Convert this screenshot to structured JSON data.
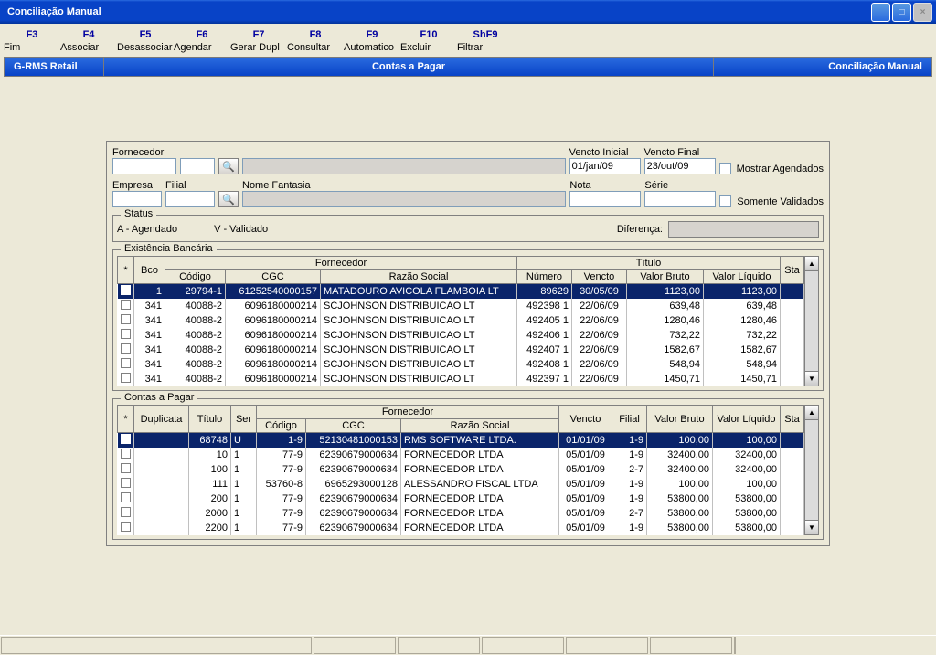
{
  "window": {
    "title": "Conciliação Manual"
  },
  "toolbar": [
    {
      "key": "F3",
      "label": "Fim"
    },
    {
      "key": "F4",
      "label": "Associar"
    },
    {
      "key": "F5",
      "label": "Desassociar"
    },
    {
      "key": "F6",
      "label": "Agendar"
    },
    {
      "key": "F7",
      "label": "Gerar Dupl"
    },
    {
      "key": "F8",
      "label": "Consultar"
    },
    {
      "key": "F9",
      "label": "Automatico"
    },
    {
      "key": "F10",
      "label": "Excluir"
    },
    {
      "key": "ShF9",
      "label": "Filtrar"
    }
  ],
  "headerbar": {
    "left": "G-RMS Retail",
    "mid": "Contas a Pagar",
    "right": "Conciliação Manual"
  },
  "filters": {
    "fornecedor_label": "Fornecedor",
    "empresa_label": "Empresa",
    "filial_label": "Filial",
    "nome_fantasia_label": "Nome Fantasia",
    "vencto_inicial_label": "Vencto Inicial",
    "vencto_final_label": "Vencto Final",
    "nota_label": "Nota",
    "serie_label": "Série",
    "vencto_inicial": "01/jan/09",
    "vencto_final": "23/out/09",
    "mostrar_agendados": "Mostrar Agendados",
    "somente_validados": "Somente Validados"
  },
  "status": {
    "group": "Status",
    "a": "A - Agendado",
    "v": "V - Validado",
    "diferenca_label": "Diferença:"
  },
  "existencia": {
    "group": "Existência Bancária",
    "header_fornecedor": "Fornecedor",
    "header_titulo": "Título",
    "cols": {
      "star": "*",
      "bco": "Bco",
      "codigo": "Código",
      "cgc": "CGC",
      "razao": "Razão Social",
      "numero": "Número",
      "vencto": "Vencto",
      "bruto": "Valor Bruto",
      "liquido": "Valor Líquido",
      "sta": "Sta"
    },
    "rows": [
      {
        "sel": true,
        "bco": "1",
        "codigo": "29794-1",
        "cgc": "61252540000157",
        "razao": "MATADOURO AVICOLA FLAMBOIA LT",
        "numero": "89629",
        "vencto": "30/05/09",
        "bruto": "1123,00",
        "liquido": "1123,00"
      },
      {
        "sel": false,
        "bco": "341",
        "codigo": "40088-2",
        "cgc": "6096180000214",
        "razao": "SCJOHNSON DISTRIBUICAO LT",
        "numero": "492398 1",
        "vencto": "22/06/09",
        "bruto": "639,48",
        "liquido": "639,48"
      },
      {
        "sel": false,
        "bco": "341",
        "codigo": "40088-2",
        "cgc": "6096180000214",
        "razao": "SCJOHNSON DISTRIBUICAO LT",
        "numero": "492405 1",
        "vencto": "22/06/09",
        "bruto": "1280,46",
        "liquido": "1280,46"
      },
      {
        "sel": false,
        "bco": "341",
        "codigo": "40088-2",
        "cgc": "6096180000214",
        "razao": "SCJOHNSON DISTRIBUICAO LT",
        "numero": "492406 1",
        "vencto": "22/06/09",
        "bruto": "732,22",
        "liquido": "732,22"
      },
      {
        "sel": false,
        "bco": "341",
        "codigo": "40088-2",
        "cgc": "6096180000214",
        "razao": "SCJOHNSON DISTRIBUICAO LT",
        "numero": "492407 1",
        "vencto": "22/06/09",
        "bruto": "1582,67",
        "liquido": "1582,67"
      },
      {
        "sel": false,
        "bco": "341",
        "codigo": "40088-2",
        "cgc": "6096180000214",
        "razao": "SCJOHNSON DISTRIBUICAO LT",
        "numero": "492408 1",
        "vencto": "22/06/09",
        "bruto": "548,94",
        "liquido": "548,94"
      },
      {
        "sel": false,
        "bco": "341",
        "codigo": "40088-2",
        "cgc": "6096180000214",
        "razao": "SCJOHNSON DISTRIBUICAO LT",
        "numero": "492397 1",
        "vencto": "22/06/09",
        "bruto": "1450,71",
        "liquido": "1450,71"
      }
    ]
  },
  "contas": {
    "group": "Contas a Pagar",
    "header_fornecedor": "Fornecedor",
    "cols": {
      "star": "*",
      "duplicata": "Duplicata",
      "titulo": "Título",
      "ser": "Ser",
      "codigo": "Código",
      "cgc": "CGC",
      "razao": "Razão Social",
      "vencto": "Vencto",
      "filial": "Filial",
      "bruto": "Valor Bruto",
      "liquido": "Valor Líquido",
      "sta": "Sta"
    },
    "rows": [
      {
        "sel": true,
        "duplicata": "",
        "titulo": "68748",
        "ser": "U",
        "codigo": "1-9",
        "cgc": "52130481000153",
        "razao": "RMS SOFTWARE LTDA.",
        "vencto": "01/01/09",
        "filial": "1-9",
        "bruto": "100,00",
        "liquido": "100,00"
      },
      {
        "sel": false,
        "duplicata": "",
        "titulo": "10",
        "ser": "1",
        "codigo": "77-9",
        "cgc": "62390679000634",
        "razao": "FORNECEDOR LTDA",
        "vencto": "05/01/09",
        "filial": "1-9",
        "bruto": "32400,00",
        "liquido": "32400,00"
      },
      {
        "sel": false,
        "duplicata": "",
        "titulo": "100",
        "ser": "1",
        "codigo": "77-9",
        "cgc": "62390679000634",
        "razao": "FORNECEDOR LTDA",
        "vencto": "05/01/09",
        "filial": "2-7",
        "bruto": "32400,00",
        "liquido": "32400,00"
      },
      {
        "sel": false,
        "duplicata": "",
        "titulo": "111",
        "ser": "1",
        "codigo": "53760-8",
        "cgc": "6965293000128",
        "razao": "ALESSANDRO FISCAL LTDA",
        "vencto": "05/01/09",
        "filial": "1-9",
        "bruto": "100,00",
        "liquido": "100,00"
      },
      {
        "sel": false,
        "duplicata": "",
        "titulo": "200",
        "ser": "1",
        "codigo": "77-9",
        "cgc": "62390679000634",
        "razao": "FORNECEDOR LTDA",
        "vencto": "05/01/09",
        "filial": "1-9",
        "bruto": "53800,00",
        "liquido": "53800,00"
      },
      {
        "sel": false,
        "duplicata": "",
        "titulo": "2000",
        "ser": "1",
        "codigo": "77-9",
        "cgc": "62390679000634",
        "razao": "FORNECEDOR LTDA",
        "vencto": "05/01/09",
        "filial": "2-7",
        "bruto": "53800,00",
        "liquido": "53800,00"
      },
      {
        "sel": false,
        "duplicata": "",
        "titulo": "2200",
        "ser": "1",
        "codigo": "77-9",
        "cgc": "62390679000634",
        "razao": "FORNECEDOR LTDA",
        "vencto": "05/01/09",
        "filial": "1-9",
        "bruto": "53800,00",
        "liquido": "53800,00"
      }
    ]
  }
}
